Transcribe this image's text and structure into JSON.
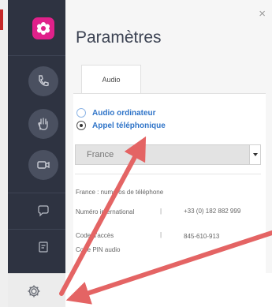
{
  "panel": {
    "title": "Paramètres",
    "close_glyph": "×",
    "tab_label": "Audio"
  },
  "audio": {
    "option_computer": "Audio ordinateur",
    "option_phone": "Appel téléphonique",
    "selected": "Appel téléphonique"
  },
  "country_select": {
    "value": "France"
  },
  "dial_info": {
    "heading": "France : numéros de téléphone",
    "rows": [
      {
        "label": "Numéro international",
        "value": "+33 (0) 182 882 999"
      },
      {
        "label": "Code d'accès",
        "value": "845-610-913"
      },
      {
        "label": "Code PIN audio",
        "value": ""
      }
    ]
  },
  "sidebar": {
    "items": [
      {
        "icon": "app-logo-icon"
      },
      {
        "icon": "phone-icon"
      },
      {
        "icon": "raise-hand-icon"
      },
      {
        "icon": "video-camera-icon"
      },
      {
        "icon": "chat-icon"
      },
      {
        "icon": "notes-icon"
      }
    ],
    "bottom_icon": "gear-icon"
  },
  "colors": {
    "rail": "#2e3341",
    "accent_link": "#2f74c8",
    "logo": "#e0218a",
    "annotation_arrow": "#e46464"
  }
}
